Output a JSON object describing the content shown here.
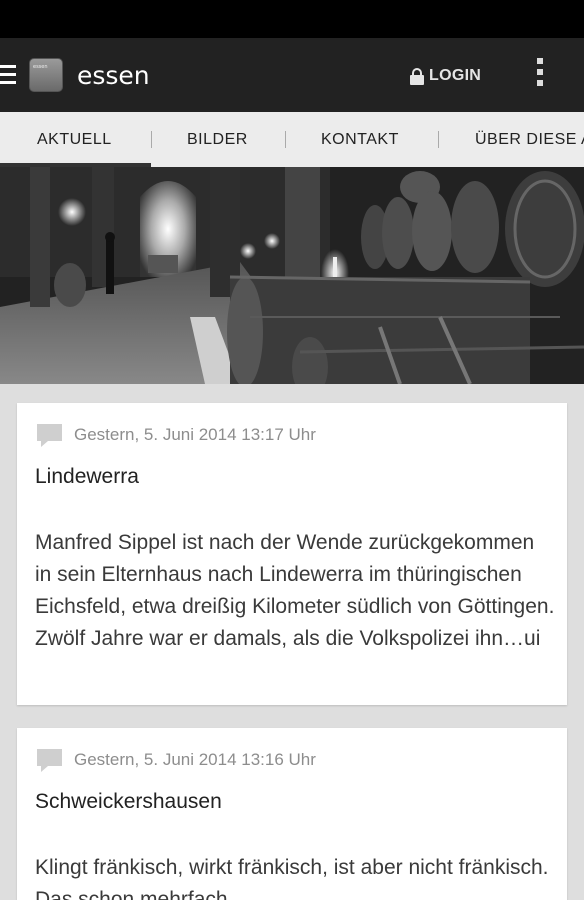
{
  "app": {
    "title": "essen",
    "logo_text": "essen",
    "login_label": "LOGIN"
  },
  "tabs": [
    {
      "label": "AKTUELL",
      "active": true
    },
    {
      "label": "BILDER",
      "active": false
    },
    {
      "label": "KONTAKT",
      "active": false
    },
    {
      "label": "ÜBER DIESE A",
      "active": false
    }
  ],
  "hero": {
    "description": "Black and white photo of a candlelit wine cellar with barrels"
  },
  "articles": [
    {
      "date": "Gestern, 5. Juni 2014 13:17 Uhr",
      "title": "Lindewerra",
      "body": "Manfred Sippel ist nach der Wende zurückgekommen in sein Elternhaus nach Lindewerra im thüringischen Eichsfeld, etwa dreißig Kilometer südlich von Göttingen. Zwölf Jahre war er damals, als die Volkspolizei ihn…ui"
    },
    {
      "date": "Gestern, 5. Juni 2014 13:16 Uhr",
      "title": "Schweickershausen",
      "body": "Klingt fränkisch, wirkt fränkisch, ist aber nicht fränkisch. Das schon mehrfach"
    }
  ],
  "colors": {
    "appbar": "#222222",
    "tabbar": "#ececec",
    "background": "#dedede"
  }
}
